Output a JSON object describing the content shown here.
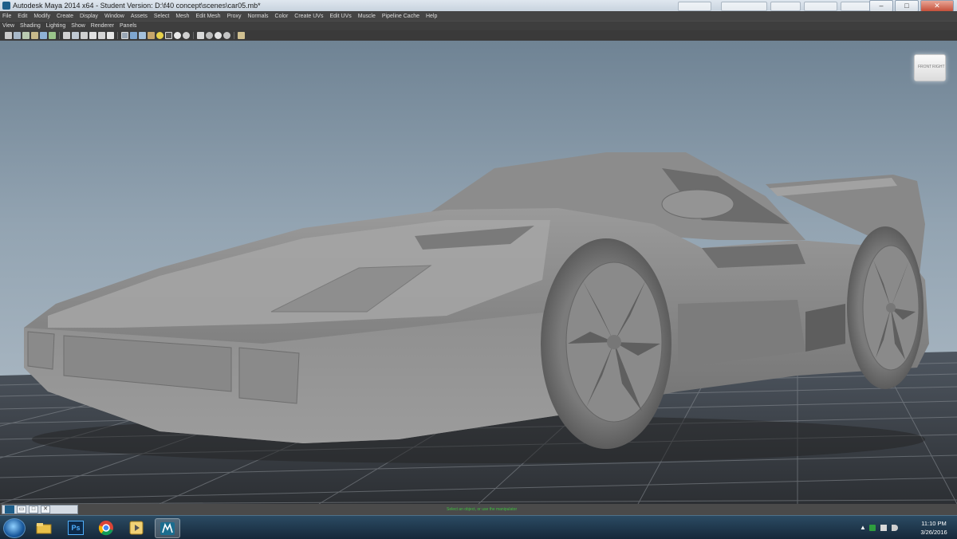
{
  "window": {
    "title": "Autodesk Maya 2014 x64 - Student Version: D:\\f40 concept\\scenes\\car05.mb*",
    "controls": {
      "minimize": "–",
      "maximize": "□",
      "close": "✕"
    }
  },
  "menubar": {
    "items": [
      "File",
      "Edit",
      "Modify",
      "Create",
      "Display",
      "Window",
      "Assets",
      "Select",
      "Mesh",
      "Edit Mesh",
      "Proxy",
      "Normals",
      "Color",
      "Create UVs",
      "Edit UVs",
      "Muscle",
      "Pipeline Cache",
      "Help"
    ]
  },
  "panel_menu": {
    "items": [
      "View",
      "Shading",
      "Lighting",
      "Show",
      "Renderer",
      "Panels"
    ]
  },
  "toolbar": {
    "icons": [
      "camera-select-icon",
      "camera-lock-icon",
      "camera-attributes-icon",
      "bookmark-icon",
      "image-plane-icon",
      "grid-toggle-icon",
      "film-gate-icon",
      "resolution-gate-icon",
      "gate-mask-icon",
      "field-chart-icon",
      "safe-action-icon",
      "safe-title-icon",
      "wireframe-icon",
      "smooth-shade-icon",
      "wireframe-on-shaded-icon",
      "textured-icon",
      "use-all-lights-icon",
      "shadows-icon",
      "ambient-occlusion-icon",
      "motion-blur-icon",
      "xray-icon",
      "xray-joints-icon",
      "isolate-select-icon",
      "backface-icon",
      "highlight-icon"
    ]
  },
  "viewport": {
    "viewcube": {
      "front": "FRONT",
      "right": "RIGHT"
    }
  },
  "helpline": {
    "icons": [
      "maya-icon",
      "restore-icon",
      "maximize-icon",
      "close-icon"
    ],
    "hint": "Select an object, or use the manipulator"
  },
  "taskbar": {
    "apps": [
      {
        "name": "file-explorer-icon",
        "active": false
      },
      {
        "name": "photoshop-icon",
        "label": "Ps",
        "active": false
      },
      {
        "name": "chrome-icon",
        "active": false
      },
      {
        "name": "media-player-icon",
        "active": false
      },
      {
        "name": "maya-app-icon",
        "active": true
      }
    ],
    "tray_icons": [
      "show-hidden-icons-icon",
      "security-icon",
      "network-icon",
      "volume-icon"
    ],
    "clock": {
      "time": "11:10 PM",
      "date": "3/26/2016"
    }
  },
  "colors": {
    "maya_ui_dark": "#444444",
    "viewport_top": "#6f8394",
    "viewport_bottom": "#b5c1cb",
    "grid_line": "#7d7d7d",
    "model_gray": "#8a8a8a",
    "taskbar": "#1f3a52"
  }
}
